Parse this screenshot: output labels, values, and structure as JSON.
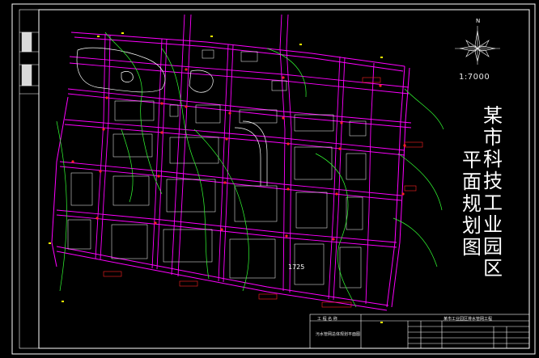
{
  "title": "某市科技工业园区平面规划图",
  "title_col1": "某市科技工业园区",
  "title_col2": "平面规划图",
  "scale": "1:7000",
  "north": "N",
  "center_number": "1725",
  "titleblock": {
    "header": "工 程 名 称",
    "project": "某市工业园区排水管网工程",
    "drawing": "污水管网总体规划平面图"
  },
  "colors": {
    "background": "#000000",
    "frame": "#ffffff",
    "road": "#ff00ff",
    "block": "#ffffff",
    "contour": "#33ff33",
    "node": "#ff2222",
    "marker": "#ffff00"
  }
}
